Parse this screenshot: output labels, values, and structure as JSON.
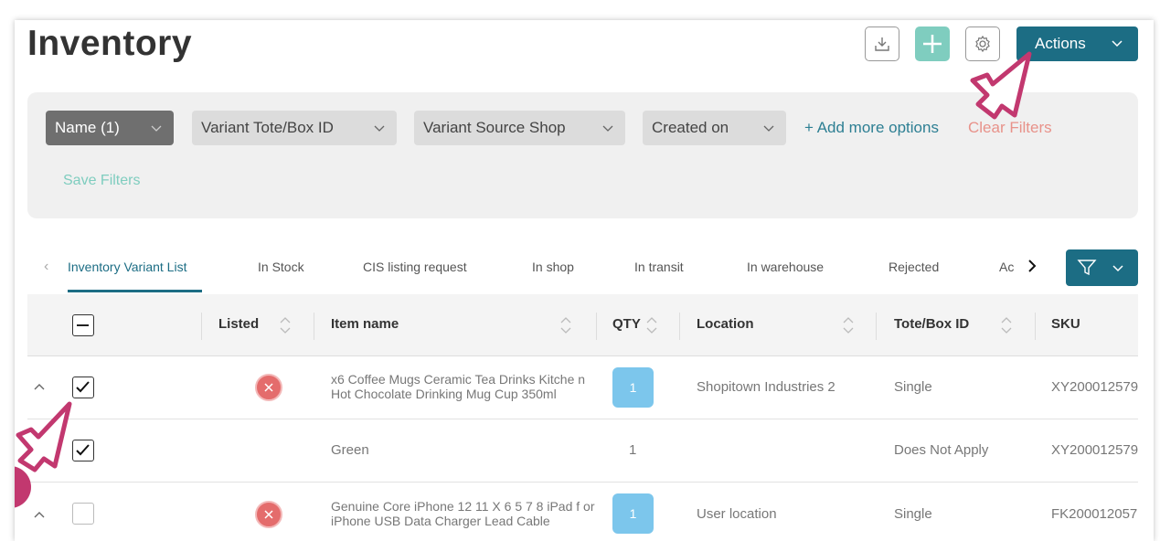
{
  "page": {
    "title": "Inventory"
  },
  "header": {
    "actions_label": "Actions"
  },
  "filters": {
    "chips": [
      "Name (1)",
      "Variant Tote/Box ID",
      "Variant Source Shop",
      "Created on"
    ],
    "add_more": "+ Add more options",
    "clear": "Clear Filters",
    "save": "Save Filters"
  },
  "tabs": [
    "Inventory Variant List",
    "In Stock",
    "CIS listing request",
    "In shop",
    "In transit",
    "In warehouse",
    "Rejected",
    "Ac"
  ],
  "table": {
    "headers": [
      "Listed",
      "Item name",
      "QTY",
      "Location",
      "Tote/Box ID",
      "SKU"
    ],
    "rows": [
      {
        "checked": true,
        "name": "x6 Coffee Mugs Ceramic Tea Drinks Kitche n Hot Chocolate Drinking Mug Cup 350ml",
        "qty": "1",
        "location": "Shopitown Industries 2",
        "tote": "Single",
        "sku": "XY200012579"
      },
      {
        "checked": true,
        "name": "Green",
        "qty": "1",
        "location": "",
        "tote": "Does Not Apply",
        "sku": "XY200012579"
      },
      {
        "checked": false,
        "name": "Genuine Core iPhone 12 11 X 6 5 7 8 iPad f or iPhone USB Data Charger Lead Cable",
        "qty": "1",
        "location": "User location",
        "tote": "Single",
        "sku": "FK200012057"
      }
    ]
  },
  "colors": {
    "accent": "#1c6d84",
    "add": "#7fcdbf",
    "clear": "#e8928a",
    "qty": "#7cc6ec",
    "unlisted": "#e46c6c",
    "pointer": "#c2386f"
  }
}
